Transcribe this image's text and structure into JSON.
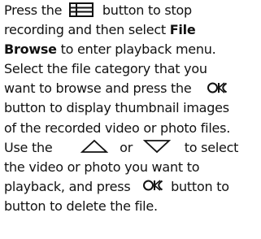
{
  "doc": {
    "line1": {
      "a": "Press the",
      "b": "button to stop"
    },
    "line2": {
      "a": "recording and then select",
      "bold": "File"
    },
    "line3": {
      "bold": "Browse",
      "a": " to enter playback menu."
    },
    "line4": {
      "a": "Select the file category that you"
    },
    "line5": {
      "a": "want to browse and press the"
    },
    "line6": {
      "a": "button to display thumbnail images"
    },
    "line7": {
      "a": "of the recorded video or photo files."
    },
    "line8": {
      "a": "Use the",
      "or": "or",
      "b": "to select"
    },
    "line9": {
      "a": "the video or photo you want to"
    },
    "line10": {
      "a": "playback, and press",
      "b": "button to"
    },
    "line11": {
      "a": "button to delete the file."
    },
    "icons": {
      "menu": "menu-button-icon",
      "ok": "ok-button-icon",
      "up": "up-triangle-icon",
      "down": "down-triangle-icon"
    }
  }
}
